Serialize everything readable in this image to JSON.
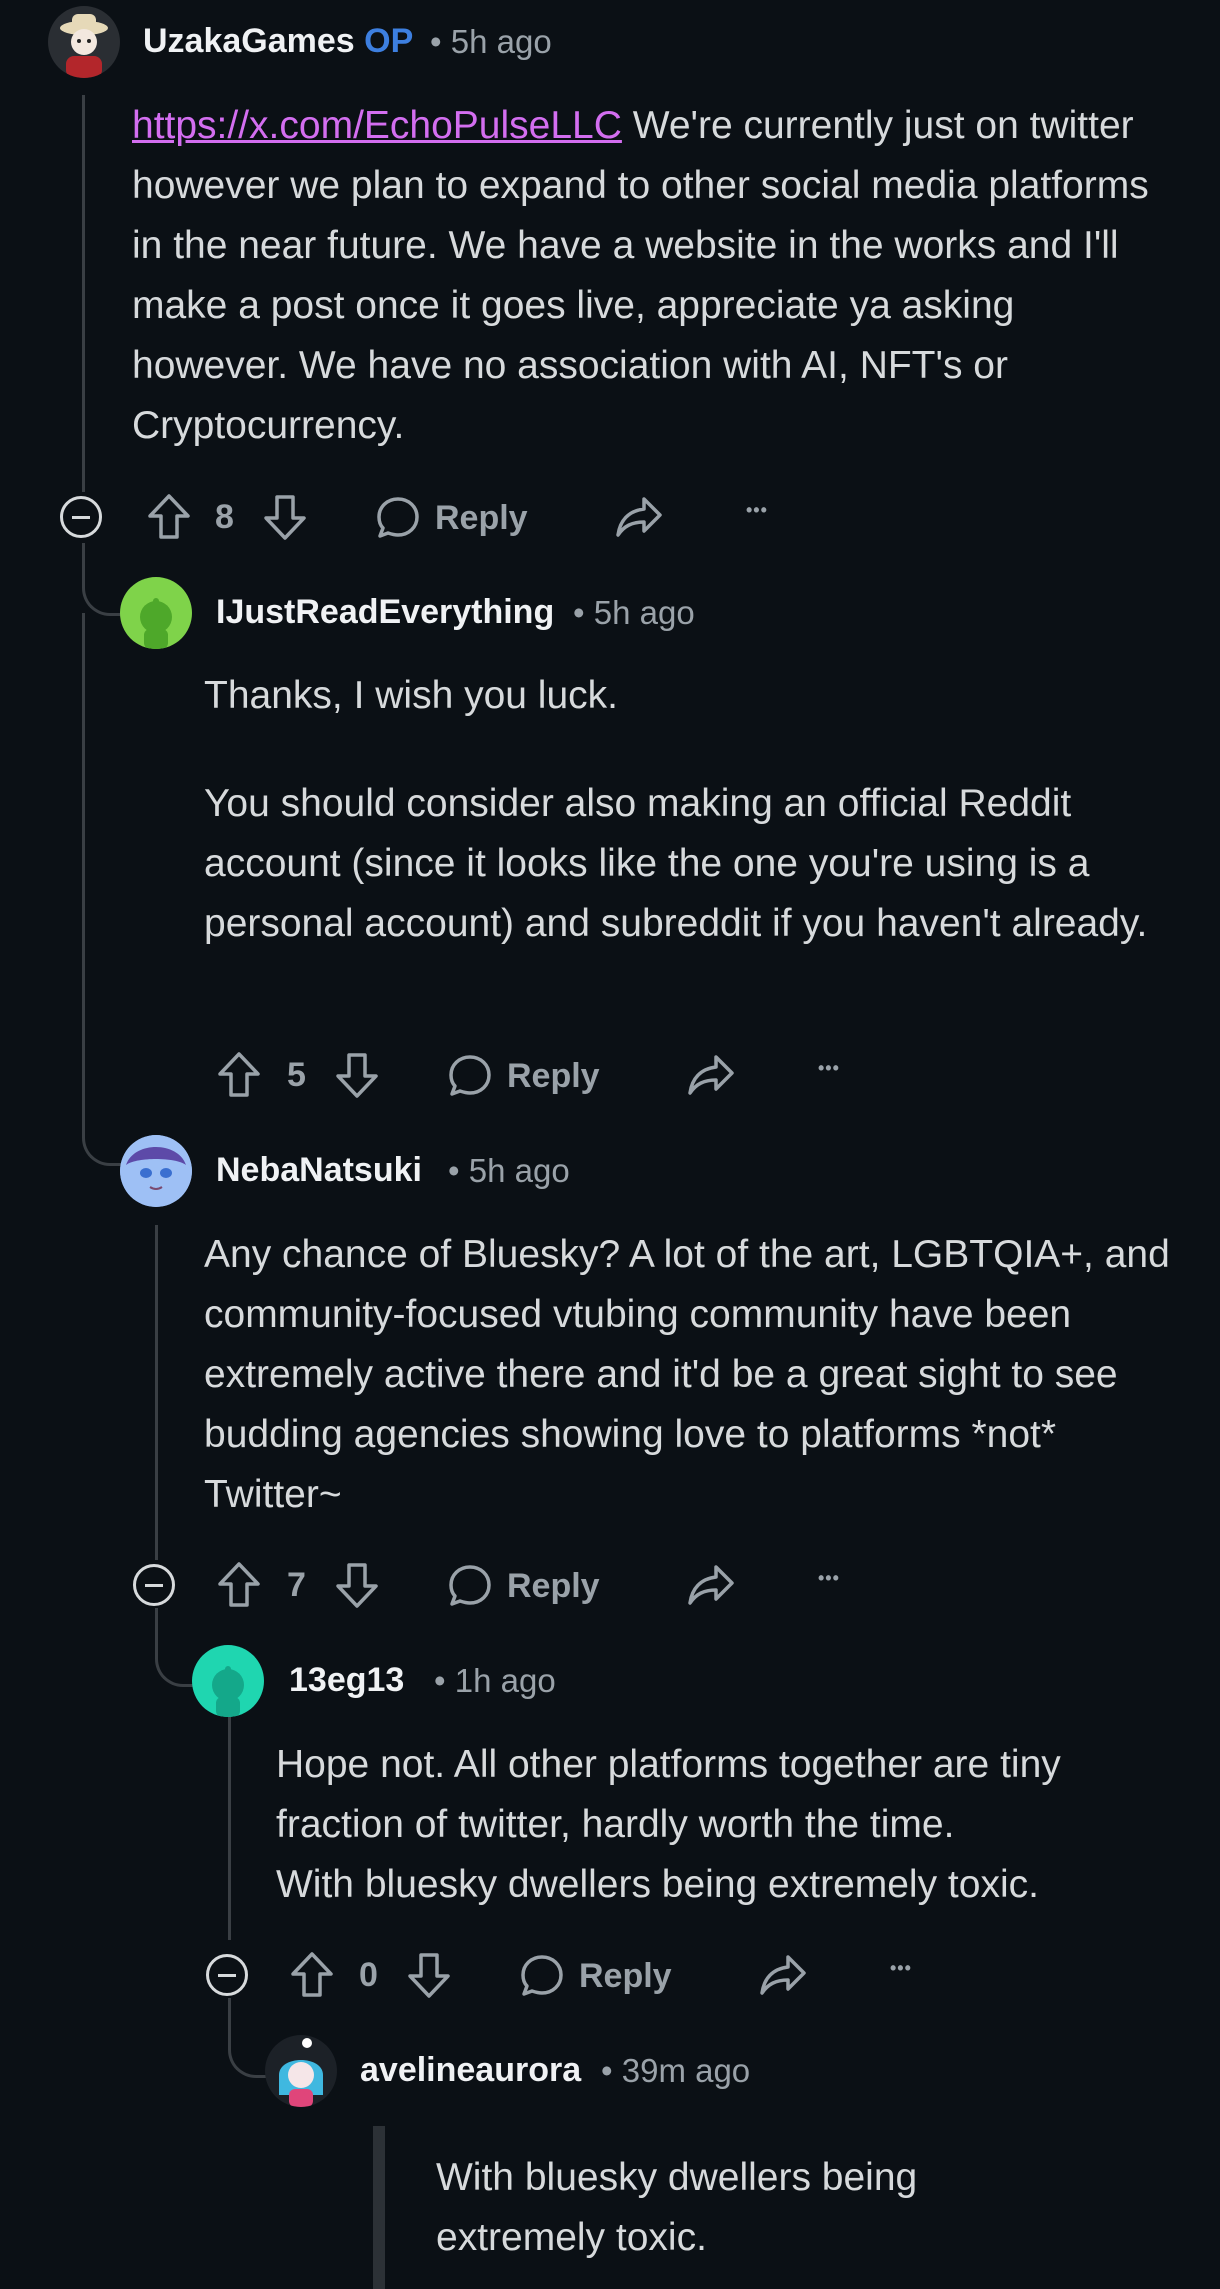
{
  "comments": [
    {
      "username": "UzakaGames",
      "op_badge": "OP",
      "separator": "•",
      "time": "5h ago",
      "link": "https://x.com/EchoPulseLLC",
      "text": " We're currently just on twitter however we plan to expand to other social media platforms in the near future. We have a website in the works and I'll make a post once it goes live, appreciate ya asking however. We have no association with AI, NFT's or Cryptocurrency.",
      "votes": "8",
      "reply_label": "Reply",
      "more": "•••"
    },
    {
      "username": "IJustReadEverything",
      "separator": "•",
      "time": "5h ago",
      "paragraphs": [
        "Thanks, I wish you luck.",
        "You should consider also making an official Reddit account (since it looks like the one you're using is a personal account) and subreddit if you haven't already."
      ],
      "votes": "5",
      "reply_label": "Reply",
      "more": "•••"
    },
    {
      "username": "NebaNatsuki",
      "separator": "•",
      "time": "5h ago",
      "text": "Any chance of Bluesky? A lot of the art, LGBTQIA+, and community-focused vtubing community have been extremely active there and it'd be a great sight to see budding agencies showing love to platforms *not* Twitter~",
      "votes": "7",
      "reply_label": "Reply",
      "more": "•••"
    },
    {
      "username": "13eg13",
      "separator": "•",
      "time": "1h ago",
      "lines": [
        "Hope not. All other platforms together are tiny fraction of twitter, hardly worth the time.",
        "With bluesky dwellers being extremely toxic."
      ],
      "votes": "0",
      "reply_label": "Reply",
      "more": "•••"
    },
    {
      "username": "avelineaurora",
      "separator": "•",
      "time": "39m ago",
      "quote": "With bluesky dwellers being extremely toxic."
    }
  ],
  "icons": {
    "upvote": "upvote-arrow-icon",
    "downvote": "downvote-arrow-icon",
    "reply": "speech-bubble-icon",
    "share": "share-arrow-icon",
    "collapse": "collapse-minus-icon"
  },
  "colors": {
    "background": "#0b1015",
    "text": "#d7dadc",
    "meta": "#9aa2a9",
    "op_badge": "#3d7fe0",
    "link": "#d36ef0"
  }
}
